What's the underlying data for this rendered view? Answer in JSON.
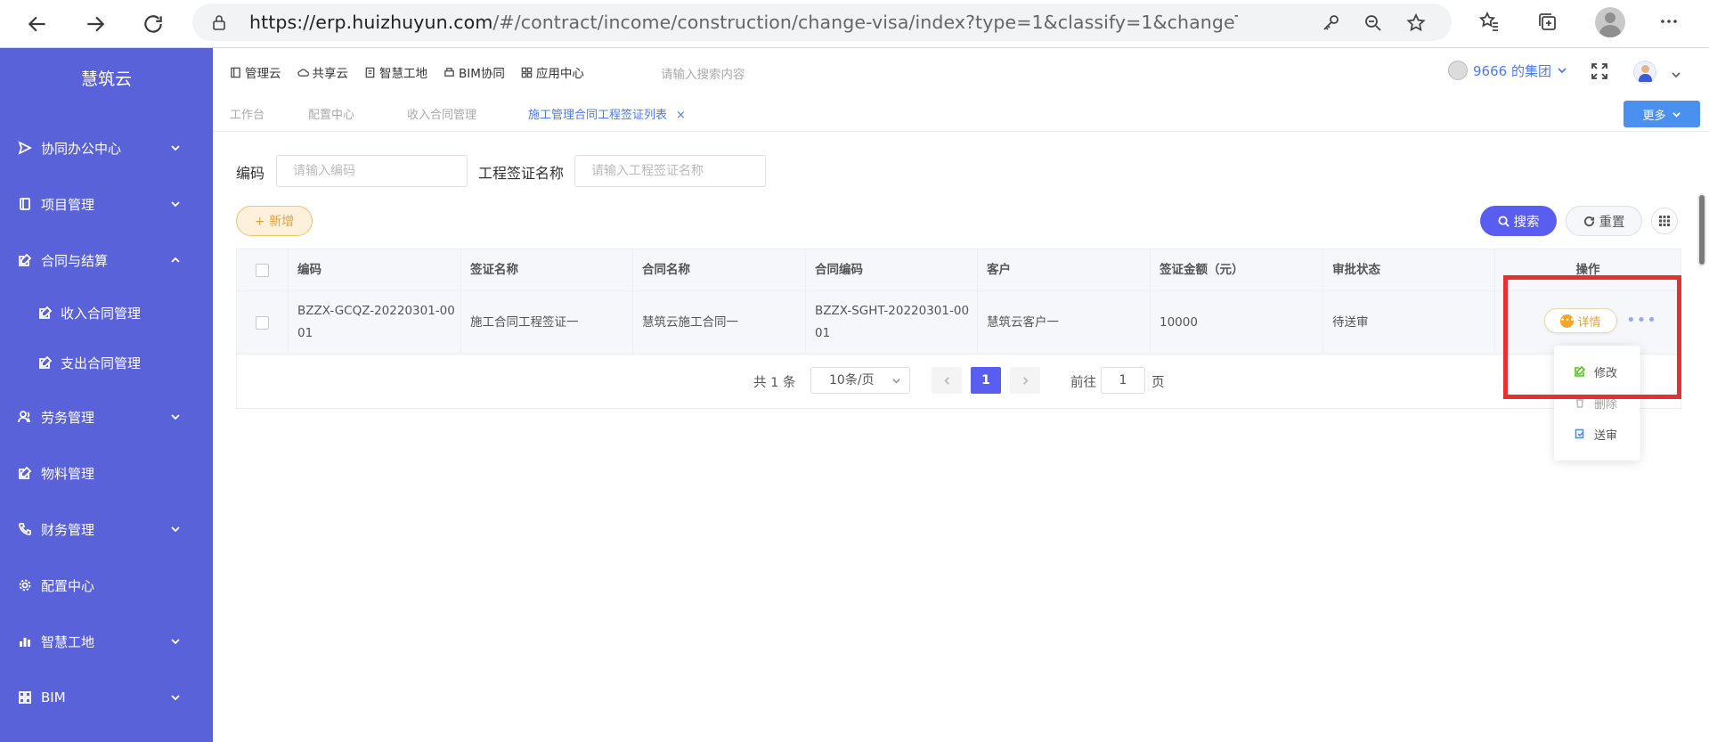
{
  "browser": {
    "url_host": "https://erp.huizhuyun.com",
    "url_path": "/#/contract/income/construction/change-visa/index?type=1&classify=1&changeType=0&hasPerm..."
  },
  "sidebar": {
    "brand": "慧筑云",
    "items": [
      {
        "label": "协同办公中心"
      },
      {
        "label": "项目管理"
      },
      {
        "label": "合同与结算"
      },
      {
        "label": "收入合同管理"
      },
      {
        "label": "支出合同管理"
      },
      {
        "label": "劳务管理"
      },
      {
        "label": "物料管理"
      },
      {
        "label": "财务管理"
      },
      {
        "label": "配置中心"
      },
      {
        "label": "智慧工地"
      },
      {
        "label": "BIM"
      }
    ]
  },
  "header": {
    "links": [
      "管理云",
      "共享云",
      "智慧工地",
      "BIM协同",
      "应用中心"
    ],
    "search_placeholder": "请输入搜索内容",
    "group": "9666 的集团"
  },
  "tabs": [
    {
      "label": "工作台"
    },
    {
      "label": "配置中心"
    },
    {
      "label": "收入合同管理"
    },
    {
      "label": "施工管理合同工程签证列表",
      "close": "×"
    }
  ],
  "more_label": "更多",
  "filters": {
    "code_label": "编码",
    "code_placeholder": "请输入编码",
    "name_label": "工程签证名称",
    "name_placeholder": "请输入工程签证名称"
  },
  "buttons": {
    "add": "+ 新增",
    "search": "搜索",
    "reset": "重置"
  },
  "table": {
    "columns": [
      "编码",
      "签证名称",
      "合同名称",
      "合同编码",
      "客户",
      "签证金额（元）",
      "审批状态",
      "操作"
    ],
    "rows": [
      {
        "code_line1": "BZZX-GCQZ-20220301-00",
        "code_line2": "01",
        "visa_name": "施工合同工程签证一",
        "contract_name": "慧筑云施工合同一",
        "contract_code_line1": "BZZX-SGHT-20220301-00",
        "contract_code_line2": "01",
        "customer": "慧筑云客户一",
        "amount": "10000",
        "status": "待送审",
        "detail": "详情",
        "more": "•••"
      }
    ]
  },
  "pager": {
    "total": "共 1 条",
    "page_size": "10条/页",
    "current": "1",
    "goto_label": "前往",
    "goto_value": "1",
    "page_label": "页"
  },
  "dropdown": {
    "items": [
      "修改",
      "删除",
      "送审"
    ]
  },
  "colors": {
    "sidebar": "#5a62d9",
    "primary": "#5a5ef0",
    "accent": "#4a7cf0",
    "warning": "#e6a23c",
    "highlight": "#e8302e"
  }
}
